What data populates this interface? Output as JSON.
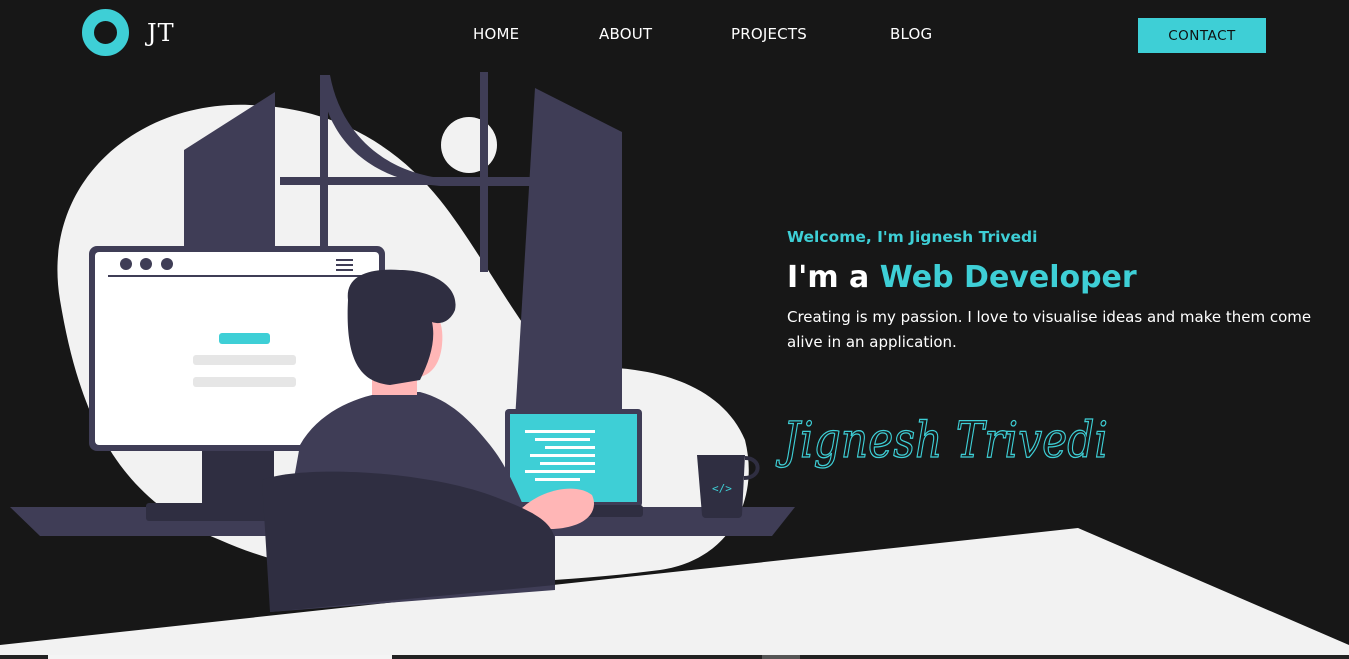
{
  "brand": {
    "logo_text": "JT",
    "accent": "#3ecfd6",
    "background": "#171717"
  },
  "nav": {
    "items": [
      {
        "label": "HOME"
      },
      {
        "label": "ABOUT"
      },
      {
        "label": "PROJECTS"
      },
      {
        "label": "BLOG"
      }
    ],
    "contact_label": "CONTACT"
  },
  "hero": {
    "welcome": "Welcome, I'm Jignesh Trivedi",
    "headline_prefix": "I'm a ",
    "headline_accent": "Web Developer",
    "description": "Creating is my passion. I love to visualise ideas and make them come alive in an application.",
    "signature": "Jignesh Trivedi"
  },
  "illustration": {
    "mug_icon": "code-brackets-icon",
    "mug_label": "</>"
  }
}
